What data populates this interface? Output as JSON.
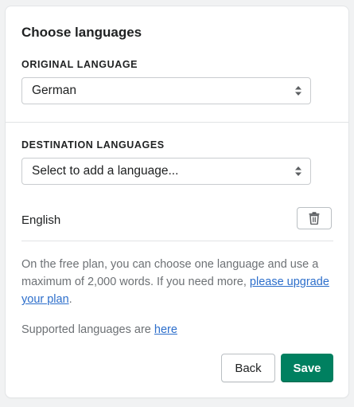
{
  "dialog": {
    "title": "Choose languages"
  },
  "original": {
    "label": "ORIGINAL LANGUAGE",
    "selected": "German"
  },
  "destination": {
    "label": "DESTINATION LANGUAGES",
    "placeholder": "Select to add a language...",
    "languages": [
      {
        "name": "English"
      }
    ]
  },
  "info": {
    "plan_text": "On the free plan, you can choose one language and use a maximum of 2,000 words. If you need more, ",
    "upgrade_link": "please upgrade your plan",
    "plan_suffix": ".",
    "supported_text": "Supported languages are ",
    "supported_link": "here"
  },
  "actions": {
    "back_label": "Back",
    "save_label": "Save"
  },
  "colors": {
    "primary": "#008060",
    "link": "#2c6ecb"
  },
  "icons": {
    "select_chevron": "updown-chevron-icon",
    "delete": "trash-icon"
  }
}
